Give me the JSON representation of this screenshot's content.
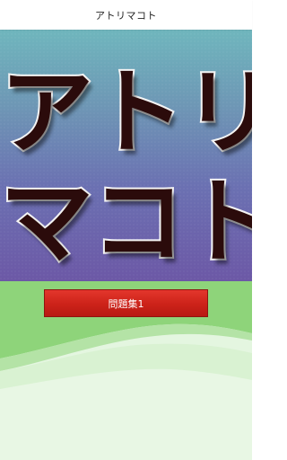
{
  "header": {
    "title": "アトリマコト"
  },
  "banner": {
    "line_1": "アトリ",
    "line_2": "マコト"
  },
  "menu": {
    "problem_set_1_label": "問題集1"
  },
  "colors": {
    "button": "#cc2219",
    "title_fill": "#2b0b0b",
    "title_stroke": "#f4f4f4",
    "lower_green": "#8ed47a"
  }
}
